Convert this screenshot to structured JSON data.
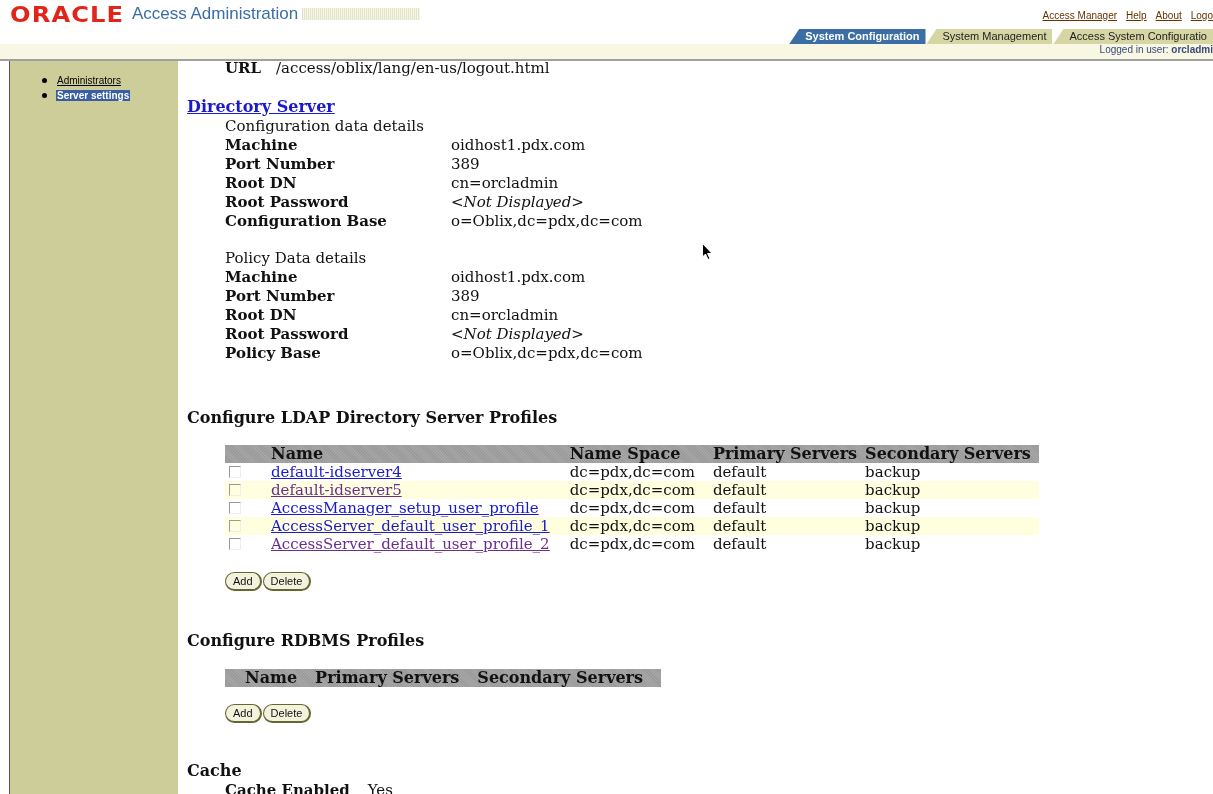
{
  "header": {
    "logo": "ORACLE",
    "product": "Access Administration",
    "global_links": [
      "Access Manager",
      "Help",
      "About",
      "Logo"
    ],
    "tabs": [
      {
        "label": "System Configuration",
        "selected": true
      },
      {
        "label": "System Management",
        "selected": false
      },
      {
        "label": "Access System Configuratio",
        "selected": false
      }
    ],
    "logged_in": "Logged in user: **orcladmi**"
  },
  "sidebar": {
    "items": [
      {
        "label": "Administrators",
        "selected": false
      },
      {
        "label": "Server settings",
        "selected": true
      }
    ]
  },
  "content": {
    "url": {
      "label": "URL",
      "value": "/access/oblix/lang/en-us/logout.html"
    },
    "directory_server": {
      "title": "Directory Server",
      "groups": [
        {
          "heading": "Configuration data details",
          "fields": [
            {
              "label": "Machine",
              "value": "oidhost1.pdx.com",
              "masked": false
            },
            {
              "label": "Port Number",
              "value": "389",
              "masked": false
            },
            {
              "label": "Root DN",
              "value": "cn=orcladmin",
              "masked": false
            },
            {
              "label": "Root Password",
              "value": "<Not Displayed>",
              "masked": true
            },
            {
              "label": "Configuration Base",
              "value": "o=Oblix,dc=pdx,dc=com",
              "masked": false
            }
          ]
        },
        {
          "heading": "Policy Data details",
          "fields": [
            {
              "label": "Machine",
              "value": "oidhost1.pdx.com",
              "masked": false
            },
            {
              "label": "Port Number",
              "value": "389",
              "masked": false
            },
            {
              "label": "Root DN",
              "value": "cn=orcladmin",
              "masked": false
            },
            {
              "label": "Root Password",
              "value": "<Not Displayed>",
              "masked": true
            },
            {
              "label": "Policy Base",
              "value": "o=Oblix,dc=pdx,dc=com",
              "masked": false
            }
          ]
        }
      ]
    },
    "ldap_profiles": {
      "title": "Configure LDAP Directory Server Profiles",
      "columns": [
        "Name",
        "Name Space",
        "Primary Servers",
        "Secondary Servers"
      ],
      "rows": [
        {
          "name": "default-idserver4",
          "name_space": "dc=pdx,dc=com",
          "primary": "default",
          "secondary": "backup",
          "checked": false,
          "visited": false
        },
        {
          "name": "default-idserver5",
          "name_space": "dc=pdx,dc=com",
          "primary": "default",
          "secondary": "backup",
          "checked": false,
          "visited": true
        },
        {
          "name": "AccessManager_setup_user_profile",
          "name_space": "dc=pdx,dc=com",
          "primary": "default",
          "secondary": "backup",
          "checked": false,
          "visited": false
        },
        {
          "name": "AccessServer_default_user_profile_1",
          "name_space": "dc=pdx,dc=com",
          "primary": "default",
          "secondary": "backup",
          "checked": false,
          "visited": false
        },
        {
          "name": "AccessServer_default_user_profile_2",
          "name_space": "dc=pdx,dc=com",
          "primary": "default",
          "secondary": "backup",
          "checked": false,
          "visited": true
        }
      ],
      "buttons": [
        "Add",
        "Delete"
      ]
    },
    "rdbms_profiles": {
      "title": "Configure RDBMS Profiles",
      "columns": [
        "Name",
        "Primary Servers",
        "Secondary Servers"
      ],
      "buttons": [
        "Add",
        "Delete"
      ]
    },
    "cache": {
      "title": "Cache",
      "fields": [
        {
          "label": "Cache Enabled",
          "value": "Yes",
          "masked": false
        }
      ]
    }
  }
}
